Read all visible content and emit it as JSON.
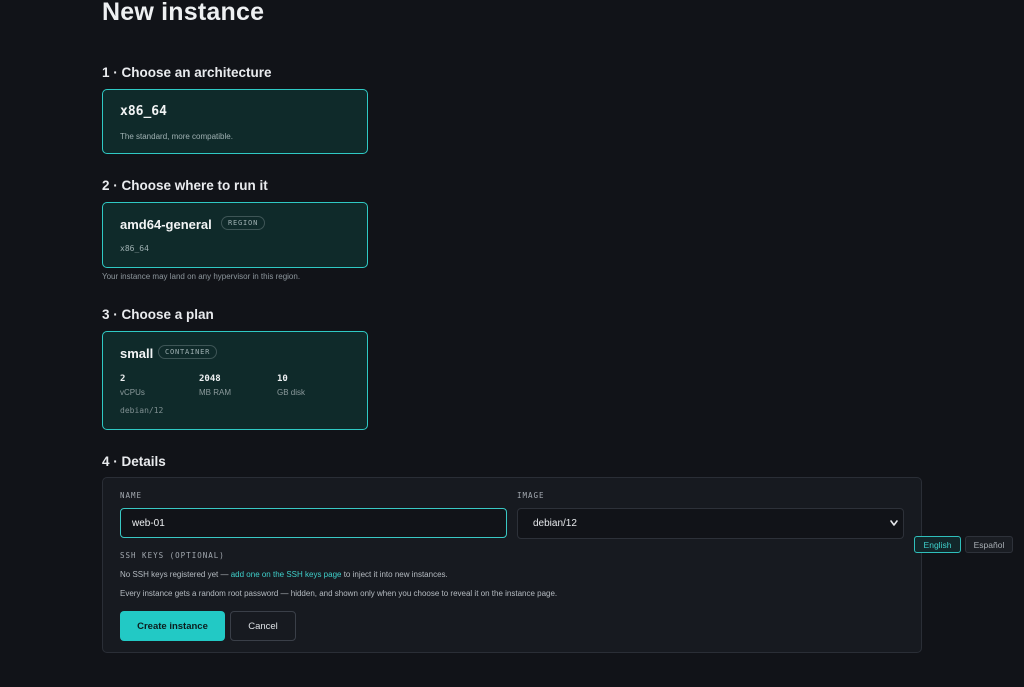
{
  "page": {
    "title": "New instance"
  },
  "sections": {
    "architecture": {
      "heading": "1 · Choose an architecture",
      "card": {
        "title": "x86_64",
        "description": "The standard, more compatible."
      }
    },
    "region": {
      "heading": "2 · Choose where to run it",
      "card": {
        "title": "amd64-general",
        "badge": "REGION",
        "arch": "x86_64"
      },
      "note": "Your instance may land on any hypervisor in this region."
    },
    "plan": {
      "heading": "3 · Choose a plan",
      "card": {
        "title": "small",
        "badge": "CONTAINER",
        "stats": [
          {
            "value": "2",
            "label": "vCPUs"
          },
          {
            "value": "2048",
            "label": "MB RAM"
          },
          {
            "value": "10",
            "label": "GB disk"
          }
        ],
        "image": "debian/12"
      }
    },
    "details": {
      "heading": "4 · Details",
      "name_label": "NAME",
      "name_value": "web-01",
      "image_label": "IMAGE",
      "image_selected": "debian/12",
      "ssh_label": "SSH KEYS (OPTIONAL)",
      "ssh_text_before": "No SSH keys registered yet — ",
      "ssh_link": "add one on the SSH keys page",
      "ssh_text_after": " to inject it into new instances.",
      "password_note": "Every instance gets a random root password — hidden, and shown only when you choose to reveal it on the instance page.",
      "create_label": "Create instance",
      "cancel_label": "Cancel"
    }
  },
  "language": {
    "english": "English",
    "spanish": "Español",
    "selected": "English"
  },
  "colors": {
    "accent": "#22c9c5",
    "card_bg": "#0f2a2a",
    "page_bg": "#111318"
  },
  "icons": {
    "select_chevron": "chevron-down-icon"
  }
}
